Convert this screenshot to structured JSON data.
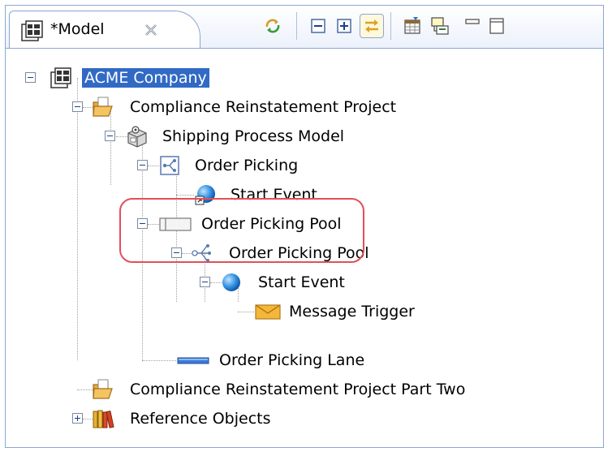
{
  "view": {
    "tab_title": "*Model",
    "tab_icon": "model-grid-icon",
    "close_icon": "close-x-icon"
  },
  "toolbar": {
    "buttons": [
      {
        "name": "sync-icon"
      },
      {
        "name": "collapse-all-icon"
      },
      {
        "name": "expand-all-icon"
      },
      {
        "name": "link-with-editor-icon"
      },
      {
        "name": "filter-table-icon"
      },
      {
        "name": "hierarchy-icon"
      },
      {
        "name": "minimize-icon"
      },
      {
        "name": "maximize-icon"
      }
    ]
  },
  "tree": {
    "items": [
      {
        "label": "ACME Company",
        "icon": "model-grid-icon",
        "selected": true,
        "expanded": true
      },
      {
        "label": "Compliance Reinstatement Project",
        "icon": "open-folder-icon",
        "expanded": true
      },
      {
        "label": "Shipping Process Model",
        "icon": "process-model-icon",
        "expanded": true
      },
      {
        "label": "Order Picking",
        "icon": "diagram-icon",
        "expanded": true
      },
      {
        "label": "Start Event",
        "icon": "start-event-shortcut-icon"
      },
      {
        "label": "Order Picking Pool",
        "icon": "pool-icon",
        "expanded": true
      },
      {
        "label": "Order Picking Pool",
        "icon": "process-tree-icon",
        "expanded": true
      },
      {
        "label": "Start Event",
        "icon": "start-event-icon",
        "expanded": true
      },
      {
        "label": "Message Trigger",
        "icon": "envelope-icon"
      },
      {
        "label": "Order Picking Lane",
        "icon": "lane-icon"
      },
      {
        "label": "Compliance Reinstatement Project Part Two",
        "icon": "open-folder-icon"
      },
      {
        "label": "Reference Objects",
        "icon": "books-icon",
        "expanded": false
      }
    ]
  },
  "colors": {
    "selection": "#316ac5",
    "highlight_ring": "#e0505a",
    "frame_border": "#8ca6d1"
  }
}
